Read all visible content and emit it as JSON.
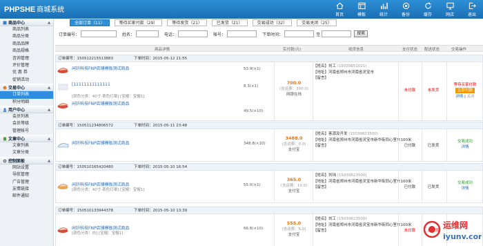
{
  "header": {
    "logo": "PHPSHE",
    "logo_sub": "商城系统",
    "nav": [
      {
        "label": "首页",
        "icon": "home-icon"
      },
      {
        "label": "模板",
        "icon": "template-icon"
      },
      {
        "label": "统计",
        "icon": "chart-icon"
      },
      {
        "label": "备份",
        "icon": "backup-icon"
      },
      {
        "label": "缓存",
        "icon": "cache-icon"
      },
      {
        "label": "网店",
        "icon": "shop-icon"
      },
      {
        "label": "退出",
        "icon": "logout-icon"
      }
    ]
  },
  "sidebar": {
    "groups": [
      {
        "title": "商品中心",
        "items": [
          "商品列表",
          "商品分类",
          "商品品牌",
          "商品规格",
          "咨询管理",
          "评价管理",
          "优 惠 券",
          "促销活动"
        ]
      },
      {
        "title": "交易中心",
        "items": [
          "订单列表",
          "积分明细"
        ]
      },
      {
        "title": "用户中心",
        "items": [
          "会员列表",
          "会员等级",
          "管理帐号"
        ]
      },
      {
        "title": "文章中心",
        "items": [
          "文章列表",
          "文章分类"
        ]
      },
      {
        "title": "控制面板",
        "items": [
          "网站设置",
          "导航管理",
          "广告管理",
          "友情链接",
          "邮件通知"
        ]
      }
    ],
    "active": "订单列表"
  },
  "tabs": [
    "全部订单（11）",
    "等待买家付款（29）",
    "等待发货（21）",
    "已发货（21）",
    "交易成功（32）",
    "交易关闭（25）"
  ],
  "search": {
    "order_no": "订单编号：",
    "name": "姓名：",
    "phone": "电话：",
    "account": "帐号：",
    "time": "下单时间：",
    "to": "至",
    "button": "搜索"
  },
  "table_header": {
    "detail": "商品详情",
    "price": "实付款(元)",
    "addr": "收货信息",
    "pay": "支付状态",
    "ship": "配送状态",
    "op": "交易操作"
  },
  "orders": [
    {
      "id_label": "订单编号：",
      "id": "150512215513883",
      "time_label": "下单时间：",
      "time": "2015-05-12 21:55",
      "products": [
        {
          "name": "闲钎科技FNP店铺模板测试商品",
          "attr": "",
          "price": "53.9",
          "qty": "(×1)"
        },
        {
          "name": "[11111111111111",
          "attr": "",
          "price": "8.3",
          "qty": "(×1)"
        },
        {
          "name": "闲钎科技FNP店铺模板测试商品",
          "attr": "[颜色分类：40寸-茶色灯罩]  [宝帽：宝帽1]",
          "price": "49.5",
          "qty": "(×10)"
        }
      ],
      "amount": "700.0",
      "freight": "(含运费：300.0)",
      "pay_method": "网银在线",
      "name_label": "【姓名】",
      "name": "刘工",
      "phone": "(15039851021)",
      "addr_label": "【地址】",
      "addr": "河南省郑州市河南省灵宝市",
      "note_label": "【留言】",
      "note": "",
      "pay_status": "未付款",
      "ship_status": "未发货",
      "op_status": "等待买家付款",
      "op_button": "立即付款",
      "op_links": [
        "详情",
        "关闭"
      ]
    },
    {
      "id_label": "订单编号：",
      "id": "150511234806572",
      "time_label": "下单时间：",
      "time": "2015-05-11 23:48",
      "products": [
        {
          "name": "闲钎科技FNP店铺模板测试商品",
          "attr": "",
          "price": "348.8",
          "qty": "(×10)"
        }
      ],
      "amount": "3488.0",
      "freight": "(含运费：0.0)",
      "pay_method": "支付宝",
      "name_label": "【姓名】",
      "name": "客源及开发",
      "phone": "(15039823500)",
      "addr_label": "【地址】",
      "addr": "河南省郑州市河南省灵宝市新华街同心室东100米",
      "note_label": "【留言】",
      "note": "",
      "pay_status": "已付款",
      "ship_status": "已发货",
      "op_status": "交易成功",
      "op_button": "",
      "op_links": [
        "详情"
      ]
    },
    {
      "id_label": "订单编号：",
      "id": "150510165420480",
      "time_label": "下单时间：",
      "time": "2015-05-10 16:54",
      "products": [
        {
          "name": "闲钎科技FNP店铺模板测试商品",
          "attr": "[颜色分类：40寸-茶色灯罩]  [宝帽：宝帽1]",
          "price": "55.0",
          "qty": "(×1)"
        }
      ],
      "amount": "365.0",
      "freight": "(含运费：10.0)",
      "pay_method": "支付宝",
      "name_label": "【姓名】",
      "name": "刘玮",
      "phone": "(15039823500)",
      "addr_label": "【地址】",
      "addr": "河南省郑州市河南省灵宝市新华街同心室东100米",
      "note_label": "【留言】",
      "note": "",
      "pay_status": "已付款",
      "ship_status": "已发货",
      "op_status": "交易成功",
      "op_button": "",
      "op_links": [
        "详情"
      ]
    },
    {
      "id_label": "订单编号：",
      "id": "150510133944378",
      "time_label": "下单时间：",
      "time": "2015-05-10 13:39",
      "products": [
        {
          "name": "闲钎科技FNP店铺模板测试商品",
          "attr": "[颜色分类：白]  [宝帽：宝帽1]",
          "price": "66.8",
          "qty": "(×10)"
        }
      ],
      "amount": "555.0",
      "freight": "(含运费：5.0)",
      "pay_method": "支付宝",
      "name_label": "【姓名】",
      "name": "刘工",
      "phone": "(15039823500)",
      "addr_label": "【地址】",
      "addr": "河南省郑州市河南省灵宝市新华街同心室东100米",
      "note_label": "【留言】",
      "note": "",
      "pay_status": "未付款",
      "ship_status": "未发货",
      "op_status": "",
      "op_button": "",
      "op_links": []
    }
  ],
  "watermark": {
    "text": "运维网",
    "url": "iyunv.com"
  }
}
